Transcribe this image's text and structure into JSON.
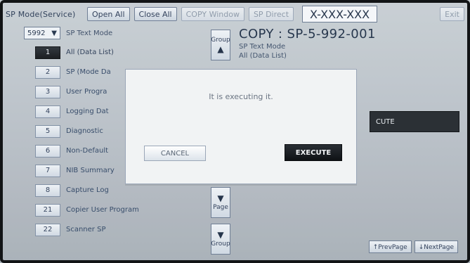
{
  "header": {
    "title": "SP Mode(Service)",
    "buttons": {
      "open_all": "Open All",
      "close_all": "Close All",
      "copy_window": "COPY Window",
      "sp_direct": "SP Direct",
      "code": "X-XXX-XXX",
      "exit": "Exit"
    }
  },
  "left": {
    "select_value": "5992",
    "select_arrow": "▼",
    "mode_label": "SP Text Mode",
    "items": [
      {
        "num": "1",
        "label": "All (Data List)",
        "active": true
      },
      {
        "num": "2",
        "label": "SP (Mode Da",
        "active": false
      },
      {
        "num": "3",
        "label": "User Progra",
        "active": false
      },
      {
        "num": "4",
        "label": "Logging Dat",
        "active": false
      },
      {
        "num": "5",
        "label": "Diagnostic",
        "active": false
      },
      {
        "num": "6",
        "label": "Non-Default",
        "active": false
      },
      {
        "num": "7",
        "label": "NIB Summary",
        "active": false
      },
      {
        "num": "8",
        "label": "Capture Log",
        "active": false
      },
      {
        "num": "21",
        "label": "Copier User Program",
        "active": false
      },
      {
        "num": "22",
        "label": "Scanner SP",
        "active": false
      }
    ]
  },
  "controls": {
    "group_up": {
      "text": "Group",
      "arrow": "▲"
    },
    "page_down": {
      "text": "Page",
      "arrow": "▼"
    },
    "group_down": {
      "text": "Group",
      "arrow": "▼"
    }
  },
  "right": {
    "title": "COPY : SP-5-992-001",
    "sub1": "SP Text Mode",
    "sub2": "All (Data List)",
    "exec_chip": "CUTE",
    "prev_page": "↑PrevPage",
    "next_page": "↓NextPage"
  },
  "dialog": {
    "message": "It is executing it.",
    "cancel": "CANCEL",
    "execute": "EXECUTE"
  },
  "colors": {
    "bezel": "#121416",
    "screen_top": "#c7ced4",
    "screen_bottom": "#a7afb7",
    "dark_button": "#13171b",
    "dialog_bg": "#f1f3f4"
  }
}
